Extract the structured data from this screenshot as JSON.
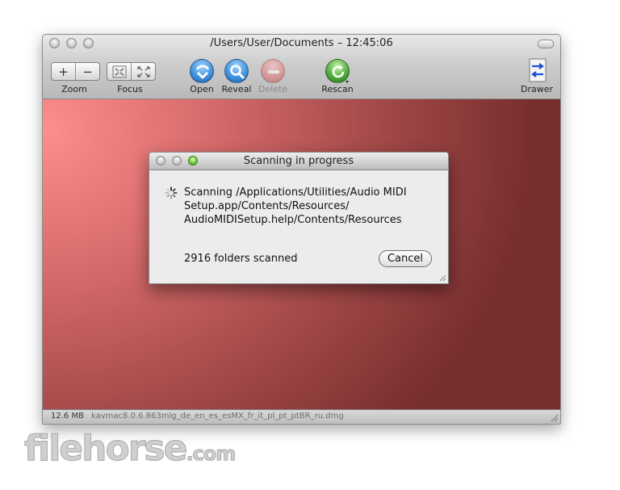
{
  "window": {
    "title": "/Users/User/Documents – 12:45:06"
  },
  "toolbar": {
    "zoom_in": "+",
    "zoom_out": "−",
    "zoom_label": "Zoom",
    "focus_label": "Focus",
    "open_label": "Open",
    "reveal_label": "Reveal",
    "delete_label": "Delete",
    "rescan_label": "Rescan",
    "drawer_label": "Drawer"
  },
  "dialog": {
    "title": "Scanning in progress",
    "message": "Scanning /Applications/Utilities/Audio MIDI Setup.app/Contents/Resources/ AudioMIDISetup.help/Contents/Resources",
    "count": "2916 folders scanned",
    "cancel_label": "Cancel"
  },
  "statusbar": {
    "size": "12.6 MB",
    "filename": "kavmac8.0.6.863mlg_de_en_es_esMX_fr_it_pl_pt_ptBR_ru.dmg"
  },
  "watermark": {
    "main": "filehorse",
    "suffix": ".com"
  },
  "colors": {
    "accent_blue": "#3d8fd9",
    "delete_red": "#e07070",
    "rescan_green": "#4aa63a"
  }
}
